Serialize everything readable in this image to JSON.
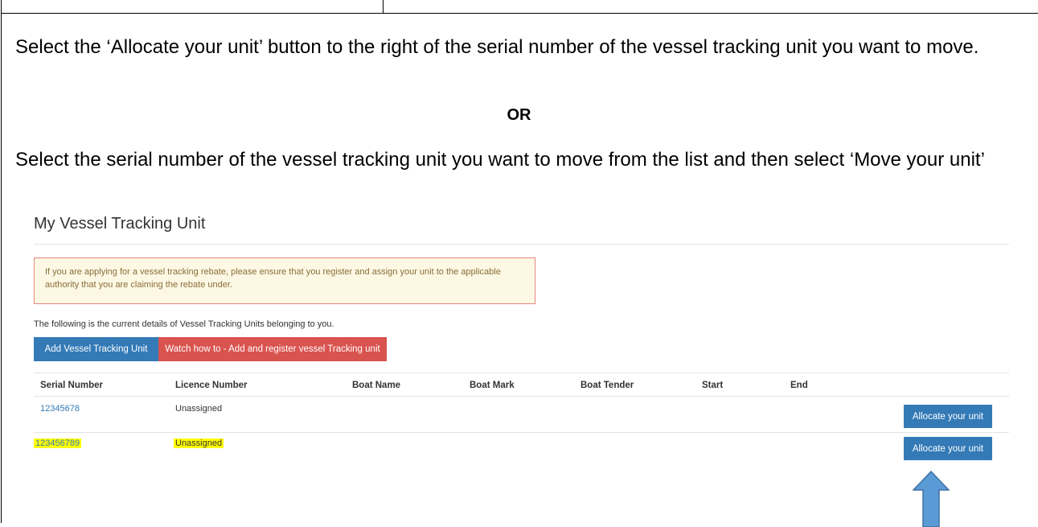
{
  "instructions": {
    "step_allocate": "Select the ‘Allocate your unit’ button to the right of the serial number of the vessel tracking unit you want to move.",
    "or_label": "OR",
    "step_move": "Select the serial number of the vessel tracking unit you want to move from the list and then select ‘Move your unit’"
  },
  "screenshot": {
    "page_title": "My Vessel Tracking Unit",
    "alert_text": "If you are applying for a vessel tracking rebate, please ensure that you register and assign your unit to the applicable authority that you are claiming the rebate under.",
    "intro_text": "The following is the current details of Vessel Tracking Units belonging to you.",
    "add_button": "Add Vessel Tracking Unit",
    "watch_button": "Watch how to - Add and register vessel Tracking unit",
    "columns": [
      "Serial Number",
      "Licence Number",
      "Boat Name",
      "Boat Mark",
      "Boat Tender",
      "Start",
      "End"
    ],
    "rows": [
      {
        "serial": "12345678",
        "licence": "Unassigned",
        "action": "Allocate your unit",
        "highlighted": false
      },
      {
        "serial": "123456789",
        "licence": "Unassigned",
        "action": "Allocate your unit",
        "highlighted": true
      }
    ]
  },
  "colors": {
    "primary": "#337ab7",
    "danger": "#d9534f",
    "warning_bg": "#fcf8e3",
    "warning_border": "#e5877e",
    "highlight": "#ffff00",
    "arrow": "#5b9bd5"
  },
  "icons": [
    "up-arrow-icon"
  ]
}
